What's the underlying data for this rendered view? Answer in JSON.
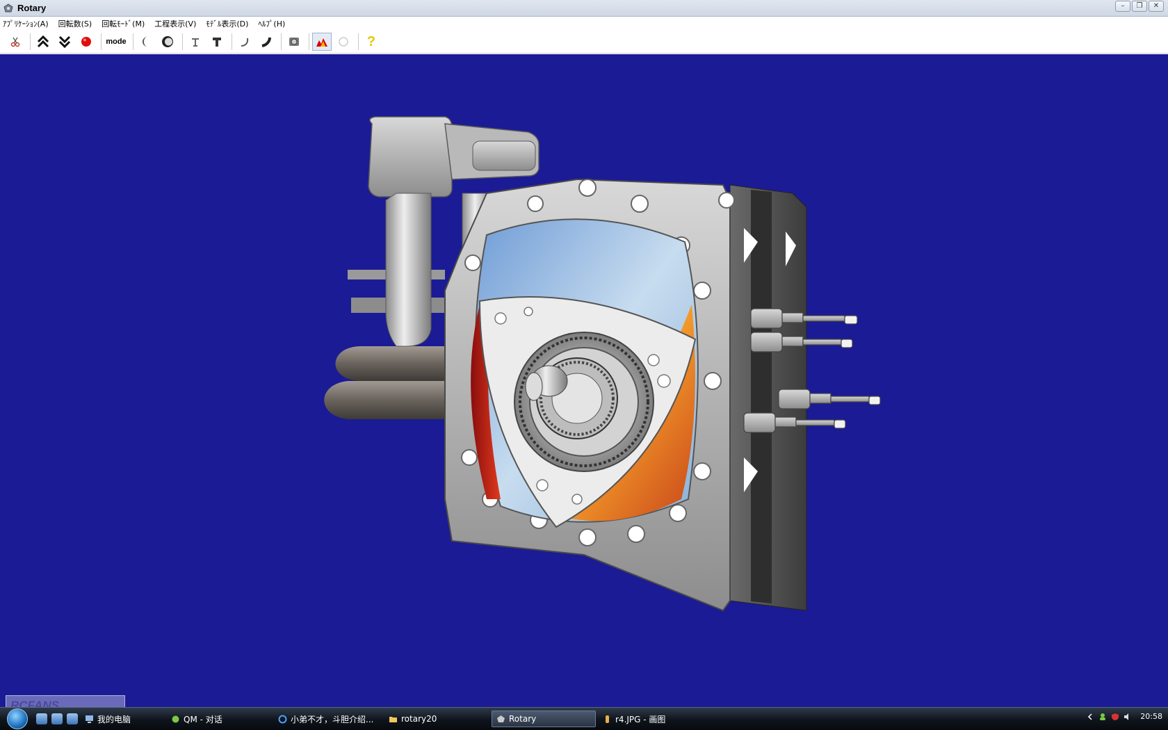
{
  "window": {
    "title": "Rotary",
    "controls": {
      "minimize": "–",
      "maximize": "❐",
      "close": "✕"
    }
  },
  "menubar": {
    "items": [
      {
        "label": "ｱﾌﾟﾘｹｰｼｮﾝ(A)"
      },
      {
        "label": "回転数(S)"
      },
      {
        "label": "回転ﾓｰﾄﾞ(M)"
      },
      {
        "label": "工程表示(V)"
      },
      {
        "label": "ﾓﾃﾞﾙ表示(D)"
      },
      {
        "label": "ﾍﾙﾌﾟ(H)"
      }
    ]
  },
  "toolbar": {
    "mode_label": "mode",
    "icons": [
      "scissors-icon",
      "double-chevron-up-icon",
      "double-chevron-down-icon",
      "red-record-icon",
      "mode-button",
      "crescent-icon",
      "eclipse-icon",
      "pin-icon",
      "pillar-icon",
      "hook-icon",
      "gear-shaft-icon",
      "engine-icon",
      "flame-icon",
      "disabled-icon",
      "help-icon"
    ],
    "help_glyph": "?"
  },
  "viewport": {
    "background": "#1b1b95"
  },
  "taskbar": {
    "buttons": [
      {
        "label": "我的电脑"
      },
      {
        "label": "QM - 对话"
      },
      {
        "label": "小弟不才，斗胆介绍..."
      },
      {
        "label": "rotary20"
      },
      {
        "label": "Rotary",
        "active": true
      },
      {
        "label": "r4.JPG - 画图"
      }
    ],
    "clock": "20:58"
  },
  "watermark": {
    "text": "RCFANS"
  }
}
